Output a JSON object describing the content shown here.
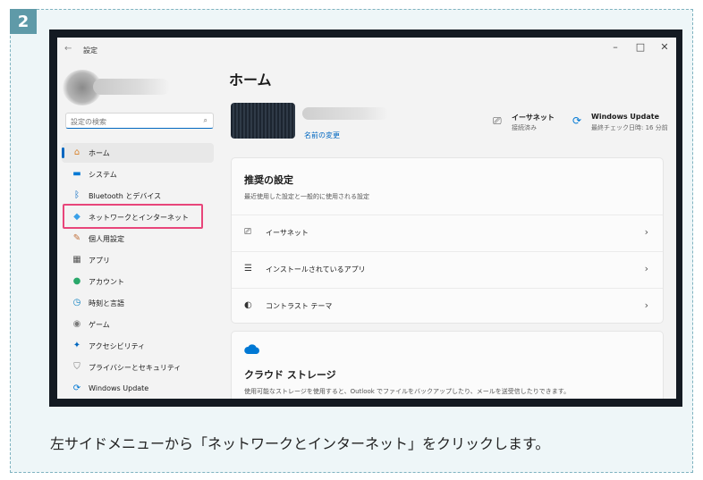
{
  "step_number": "2",
  "window": {
    "back_glyph": "←",
    "title": "設定",
    "controls": {
      "minimize": "–",
      "maximize": "□",
      "close": "✕"
    }
  },
  "sidebar": {
    "search_placeholder": "設定の検索",
    "items": [
      {
        "label": "ホーム",
        "icon": "home-icon",
        "glyph": "⌂",
        "color": "#d9822b",
        "selected": true
      },
      {
        "label": "システム",
        "icon": "system-icon",
        "glyph": "▬",
        "color": "#0078d4"
      },
      {
        "label": "Bluetooth とデバイス",
        "icon": "bluetooth-icon",
        "glyph": "ᛒ",
        "color": "#0067c0"
      },
      {
        "label": "ネットワークとインターネット",
        "icon": "network-icon",
        "glyph": "◆",
        "color": "#3aa0e8"
      },
      {
        "label": "個人用設定",
        "icon": "brush-icon",
        "glyph": "✎",
        "color": "#c0703a"
      },
      {
        "label": "アプリ",
        "icon": "apps-icon",
        "glyph": "▦",
        "color": "#555555"
      },
      {
        "label": "アカウント",
        "icon": "account-icon",
        "glyph": "●",
        "color": "#2aa86b"
      },
      {
        "label": "時刻と言語",
        "icon": "clock-icon",
        "glyph": "◷",
        "color": "#0a7fc0"
      },
      {
        "label": "ゲーム",
        "icon": "gamepad-icon",
        "glyph": "◉",
        "color": "#7a7a7a"
      },
      {
        "label": "アクセシビリティ",
        "icon": "accessibility-icon",
        "glyph": "✦",
        "color": "#0067c0"
      },
      {
        "label": "プライバシーとセキュリティ",
        "icon": "shield-icon",
        "glyph": "⛉",
        "color": "#7a7a7a"
      },
      {
        "label": "Windows Update",
        "icon": "windows-update-icon",
        "glyph": "⟳",
        "color": "#0078d4"
      }
    ]
  },
  "main": {
    "title": "ホーム",
    "rename_link": "名前の変更",
    "status": [
      {
        "icon": "ethernet-icon",
        "glyph": "⎚",
        "title": "イーサネット",
        "sub": "接続済み"
      },
      {
        "icon": "windows-update-icon",
        "glyph": "⟳",
        "title": "Windows Update",
        "sub": "最終チェック日時: 16 分前"
      }
    ],
    "recommended": {
      "heading": "推奨の設定",
      "subtitle": "最近使用した設定と一般的に使用される設定",
      "rows": [
        {
          "icon": "ethernet-icon",
          "glyph": "⎚",
          "label": "イーサネット"
        },
        {
          "icon": "installed-apps-icon",
          "glyph": "☰",
          "label": "インストールされているアプリ"
        },
        {
          "icon": "contrast-icon",
          "glyph": "◐",
          "label": "コントラスト テーマ"
        }
      ],
      "chevron": "›"
    },
    "cloud": {
      "heading": "クラウド ストレージ",
      "text": "使用可能なストレージを使用すると、Outlook でファイルをバックアップしたり、メールを送受信したりできます。",
      "icon_color": "#0078d4"
    }
  },
  "caption": "左サイドメニューから「ネットワークとインターネット」をクリックします。",
  "colors": {
    "accent": "#0067c0",
    "highlight": "#e8457a",
    "step_badge": "#5f9aa8"
  }
}
